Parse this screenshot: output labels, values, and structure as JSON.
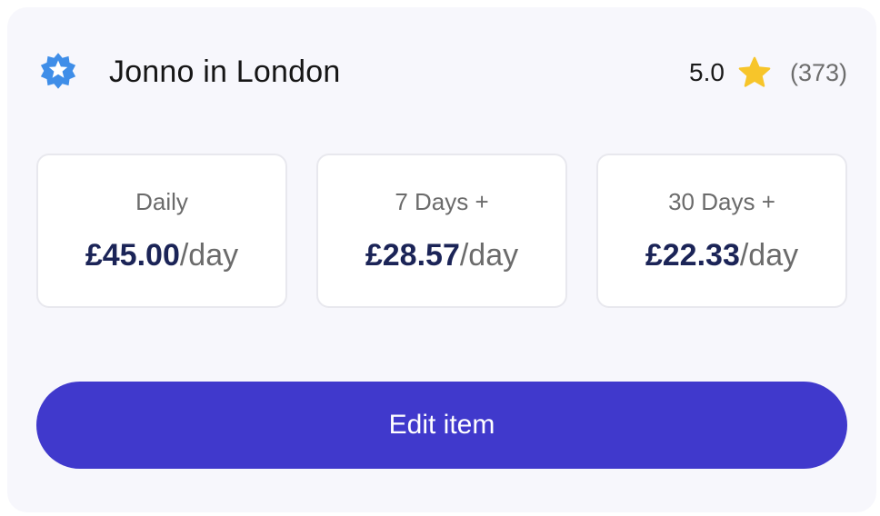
{
  "listing": {
    "owner_name": "Jonno in London",
    "badge_icon": "verified-badge-icon",
    "badge_color": "#3f8ee8"
  },
  "rating": {
    "value": "5.0",
    "icon": "star-icon",
    "star_color": "#f7c52a",
    "count": "(373)"
  },
  "prices": [
    {
      "period": "Daily",
      "amount": "£45.00",
      "unit": "/day"
    },
    {
      "period": "7 Days +",
      "amount": "£28.57",
      "unit": "/day"
    },
    {
      "period": "30 Days +",
      "amount": "£22.33",
      "unit": "/day"
    }
  ],
  "actions": {
    "edit_label": "Edit item",
    "button_color": "#4039cc"
  }
}
